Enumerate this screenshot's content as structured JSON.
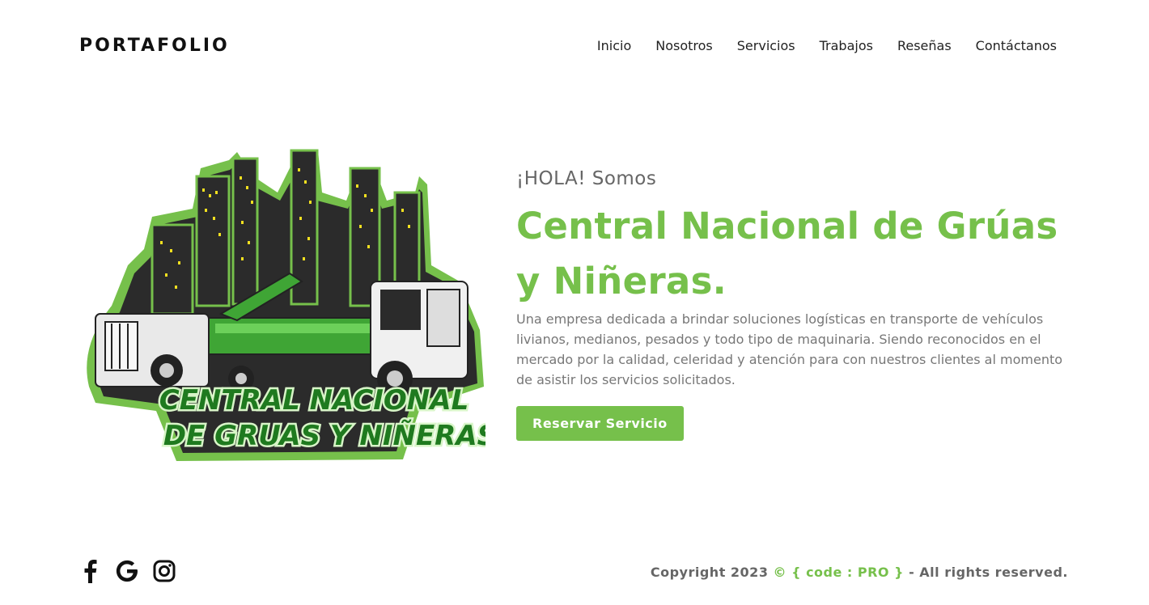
{
  "header": {
    "brand": "PORTAFOLIO",
    "nav": [
      "Inicio",
      "Nosotros",
      "Servicios",
      "Trabajos",
      "Reseñas",
      "Contáctanos"
    ]
  },
  "logo": {
    "line1": "CENTRAL NACIONAL",
    "line2": "DE GRUAS Y NIÑERAS"
  },
  "hero": {
    "greeting": "¡HOLA! Somos",
    "headline": "Central Nacional de Grúas y Niñeras.",
    "description": "Una empresa dedicada a brindar soluciones logísticas en transporte de vehículos livianos, medianos, pesados y todo tipo de maquinaria. Siendo reconocidos en el mercado por la calidad, celeridad y atención para con nuestros clientes al momento de asistir los servicios solicitados.",
    "cta_label": "Reservar Servicio"
  },
  "footer": {
    "social_icons": [
      "facebook-icon",
      "google-icon",
      "instagram-icon"
    ],
    "copyright_prefix": "Copyright 2023",
    "copyright_accent": "© { code : PRO }",
    "copyright_suffix": "- All rights reserved."
  },
  "colors": {
    "accent": "#76c04b",
    "dark": "#2d2d2d",
    "text_muted": "#777777"
  }
}
